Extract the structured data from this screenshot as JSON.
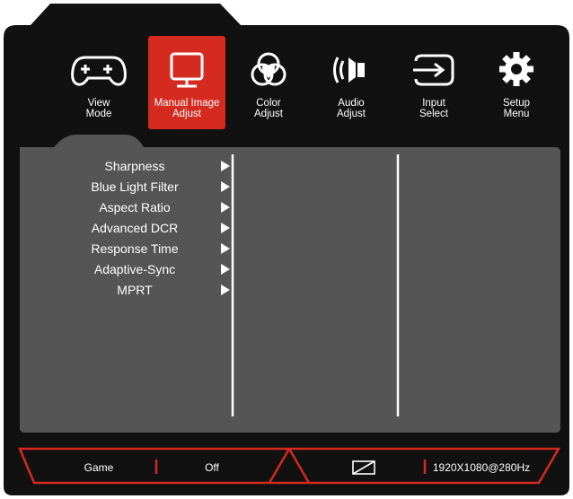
{
  "tabs": [
    {
      "id": "view-mode",
      "label": "View\nMode",
      "icon": "gamepad-icon",
      "active": false
    },
    {
      "id": "manual-image-adjust",
      "label": "Manual Image\nAdjust",
      "icon": "monitor-icon",
      "active": true
    },
    {
      "id": "color-adjust",
      "label": "Color\nAdjust",
      "icon": "color-circles-icon",
      "active": false
    },
    {
      "id": "audio-adjust",
      "label": "Audio\nAdjust",
      "icon": "speaker-icon",
      "active": false
    },
    {
      "id": "input-select",
      "label": "Input\nSelect",
      "icon": "input-arrow-icon",
      "active": false
    },
    {
      "id": "setup-menu",
      "label": "Setup\nMenu",
      "icon": "gear-icon",
      "active": false
    }
  ],
  "menu": {
    "items": [
      {
        "label": "Sharpness"
      },
      {
        "label": "Blue Light Filter"
      },
      {
        "label": "Aspect Ratio"
      },
      {
        "label": "Advanced DCR"
      },
      {
        "label": "Response Time"
      },
      {
        "label": "Adaptive-Sync"
      },
      {
        "label": "MPRT"
      }
    ]
  },
  "status_bar": {
    "mode": "Game",
    "setting": "Off",
    "display_icon": "aspect-box-icon",
    "resolution": "1920X1080@280Hz"
  },
  "colors": {
    "background": "#111111",
    "panel": "#555555",
    "accent": "#d42a1f",
    "text": "#ffffff"
  }
}
